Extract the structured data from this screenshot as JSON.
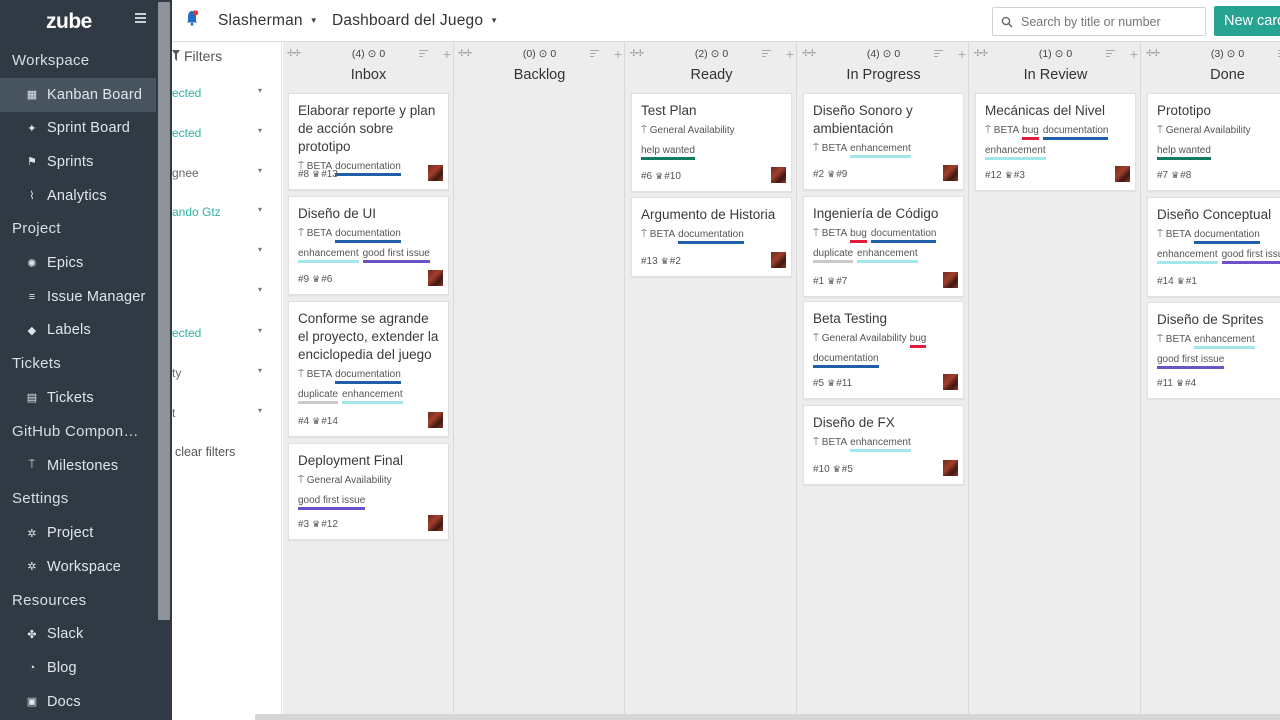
{
  "sidebar": {
    "logo": "zube",
    "sections": [
      {
        "title": "Workspace",
        "items": [
          {
            "label": "Kanban Board",
            "icon": "kanban-icon",
            "active": true
          },
          {
            "label": "Sprint Board",
            "icon": "sprint-icon"
          },
          {
            "label": "Sprints",
            "icon": "flag-icon"
          },
          {
            "label": "Analytics",
            "icon": "chart-icon"
          }
        ]
      },
      {
        "title": "Project",
        "items": [
          {
            "label": "Epics",
            "icon": "epics-icon"
          },
          {
            "label": "Issue Manager",
            "icon": "list-icon"
          },
          {
            "label": "Labels",
            "icon": "tag-icon"
          }
        ]
      },
      {
        "title": "Tickets",
        "items": [
          {
            "label": "Tickets",
            "icon": "ticket-icon"
          }
        ]
      },
      {
        "title": "GitHub Components",
        "items": [
          {
            "label": "Milestones",
            "icon": "milestone-icon"
          }
        ]
      },
      {
        "title": "Settings",
        "items": [
          {
            "label": "Project",
            "icon": "gear-icon"
          },
          {
            "label": "Workspace",
            "icon": "gear-icon"
          }
        ]
      },
      {
        "title": "Resources",
        "items": [
          {
            "label": "Slack",
            "icon": "slack-icon"
          },
          {
            "label": "Blog",
            "icon": "rss-icon"
          },
          {
            "label": "Docs",
            "icon": "docs-icon"
          }
        ]
      }
    ]
  },
  "topbar": {
    "workspace": "Slasherman",
    "project": "Dashboard del Juego",
    "search_placeholder": "Search by title or number",
    "new_card": "New card"
  },
  "filters": {
    "title": "Filters",
    "rows": [
      "ected",
      "ected",
      "gnee",
      "ando Gtz",
      "",
      "",
      "ected",
      "ty",
      "t"
    ],
    "clear": "clear filters"
  },
  "colors": {
    "documentation": "#1f5fa8",
    "enhancement": "#a2e6ea",
    "good first issue": "#6b52c8",
    "bug": "#e01b3c",
    "duplicate": "#c9c9c9",
    "help wanted": "#137a62",
    "accent": "#27a392",
    "sidebar": "#2f3a45"
  },
  "columns": [
    {
      "title": "Inbox",
      "count": "(4)",
      "points": "0",
      "cards": [
        {
          "title": "Elaborar reporte y plan de acción sobre prototipo",
          "milestone": "BETA",
          "labels": [
            "documentation"
          ],
          "num": "#8",
          "trophy": "#13"
        },
        {
          "title": "Diseño de UI",
          "milestone": "BETA",
          "labels": [
            "documentation",
            "enhancement",
            "good first issue"
          ],
          "num": "#9",
          "trophy": "#6"
        },
        {
          "title": "Conforme se agrande el proyecto, extender la enciclopedia del juego",
          "milestone": "BETA",
          "labels": [
            "documentation",
            "duplicate",
            "enhancement"
          ],
          "num": "#4",
          "trophy": "#14"
        },
        {
          "title": "Deployment Final",
          "milestone": "General Availability",
          "labels": [
            "good first issue"
          ],
          "num": "#3",
          "trophy": "#12"
        }
      ]
    },
    {
      "title": "Backlog",
      "count": "(0)",
      "points": "0",
      "cards": []
    },
    {
      "title": "Ready",
      "count": "(2)",
      "points": "0",
      "cards": [
        {
          "title": "Test Plan",
          "milestone": "General Availability",
          "labels": [
            "help wanted"
          ],
          "num": "#6",
          "trophy": "#10"
        },
        {
          "title": "Argumento de Historia",
          "milestone": "BETA",
          "labels": [
            "documentation"
          ],
          "num": "#13",
          "trophy": "#2"
        }
      ]
    },
    {
      "title": "In Progress",
      "count": "(4)",
      "points": "0",
      "cards": [
        {
          "title": "Diseño Sonoro y ambientación",
          "milestone": "BETA",
          "labels": [
            "enhancement"
          ],
          "num": "#2",
          "trophy": "#9"
        },
        {
          "title": "Ingeniería de Código",
          "milestone": "BETA",
          "labels": [
            "bug",
            "documentation",
            "duplicate",
            "enhancement"
          ],
          "num": "#1",
          "trophy": "#7"
        },
        {
          "title": "Beta Testing",
          "milestone": "General Availability",
          "labels": [
            "bug",
            "documentation"
          ],
          "num": "#5",
          "trophy": "#11"
        },
        {
          "title": "Diseño de FX",
          "milestone": "BETA",
          "labels": [
            "enhancement"
          ],
          "num": "#10",
          "trophy": "#5"
        }
      ]
    },
    {
      "title": "In Review",
      "count": "(1)",
      "points": "0",
      "cards": [
        {
          "title": "Mecánicas del Nivel",
          "milestone": "BETA",
          "labels": [
            "bug",
            "documentation",
            "enhancement"
          ],
          "num": "#12",
          "trophy": "#3"
        }
      ]
    },
    {
      "title": "Done",
      "count": "(3)",
      "points": "0",
      "cards": [
        {
          "title": "Prototipo",
          "milestone": "General Availability",
          "labels": [
            "help wanted"
          ],
          "num": "#7",
          "trophy": "#8"
        },
        {
          "title": "Diseño Conceptual",
          "milestone": "BETA",
          "labels": [
            "documentation",
            "enhancement",
            "good first issue"
          ],
          "num": "#14",
          "trophy": "#1"
        },
        {
          "title": "Diseño de Sprites",
          "milestone": "BETA",
          "labels": [
            "enhancement",
            "good first issue"
          ],
          "num": "#11",
          "trophy": "#4"
        }
      ]
    }
  ]
}
